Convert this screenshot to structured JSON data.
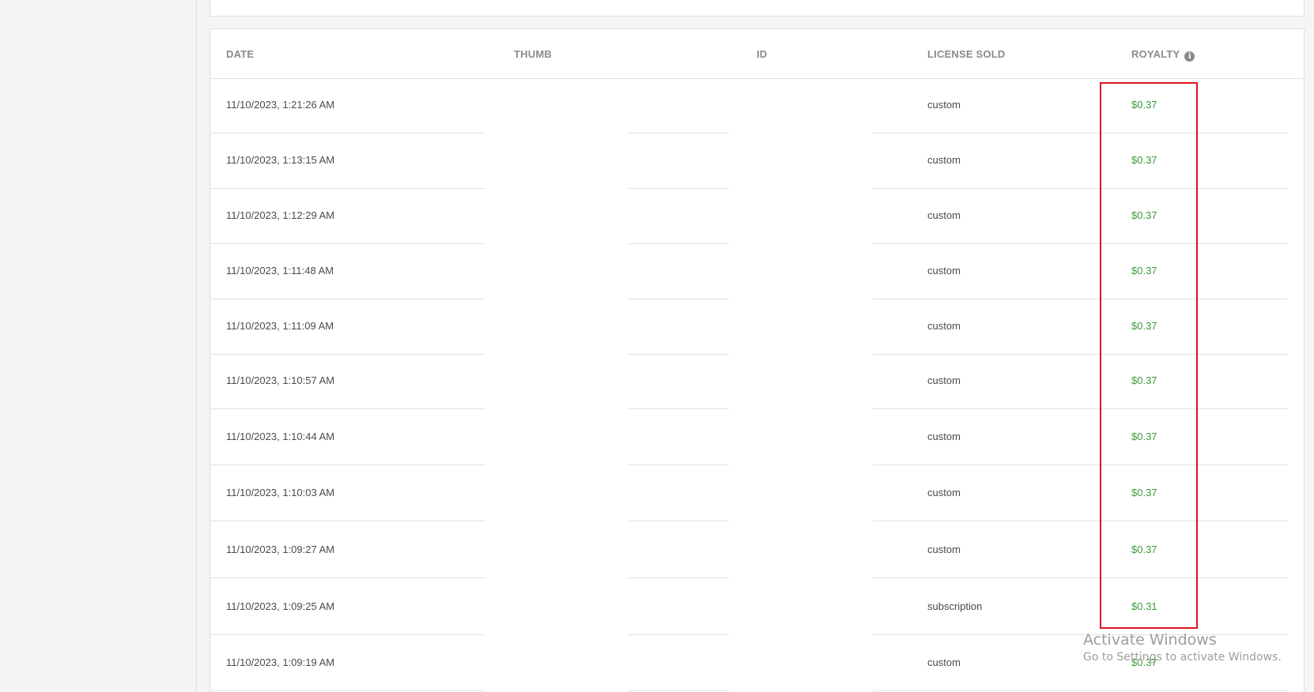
{
  "table": {
    "headers": {
      "date": "DATE",
      "thumb": "THUMB",
      "id": "ID",
      "license": "LICENSE SOLD",
      "royalty": "ROYALTY"
    },
    "rows": [
      {
        "date": "11/10/2023, 1:21:26 AM",
        "license": "custom",
        "royalty": "$0.37"
      },
      {
        "date": "11/10/2023, 1:13:15 AM",
        "license": "custom",
        "royalty": "$0.37"
      },
      {
        "date": "11/10/2023, 1:12:29 AM",
        "license": "custom",
        "royalty": "$0.37"
      },
      {
        "date": "11/10/2023, 1:11:48 AM",
        "license": "custom",
        "royalty": "$0.37"
      },
      {
        "date": "11/10/2023, 1:11:09 AM",
        "license": "custom",
        "royalty": "$0.37"
      },
      {
        "date": "11/10/2023, 1:10:57 AM",
        "license": "custom",
        "royalty": "$0.37"
      },
      {
        "date": "11/10/2023, 1:10:44 AM",
        "license": "custom",
        "royalty": "$0.37"
      },
      {
        "date": "11/10/2023, 1:10:03 AM",
        "license": "custom",
        "royalty": "$0.37"
      },
      {
        "date": "11/10/2023, 1:09:27 AM",
        "license": "custom",
        "royalty": "$0.37"
      },
      {
        "date": "11/10/2023, 1:09:25 AM",
        "license": "subscription",
        "royalty": "$0.31"
      },
      {
        "date": "11/10/2023, 1:09:19 AM",
        "license": "custom",
        "royalty": "$0.37"
      }
    ]
  },
  "icons": {
    "royalty_info": "info-icon",
    "royalty_info_glyph": "i"
  },
  "watermark": {
    "title": "Activate Windows",
    "subtitle": "Go to Settings to activate Windows."
  },
  "colors": {
    "royalty_text": "#3a9a3a",
    "highlight_border": "#e0141e",
    "header_text": "#8a8a8a"
  }
}
